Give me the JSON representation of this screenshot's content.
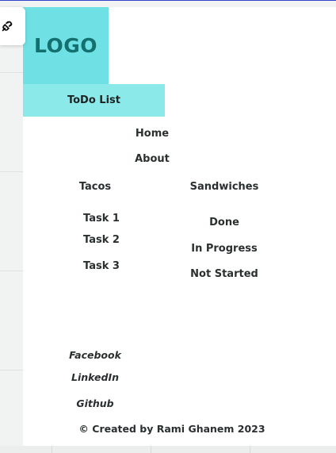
{
  "logo": {
    "text": "LOGO"
  },
  "sidebar": {
    "title": "ToDo List"
  },
  "nav": {
    "home": "Home",
    "about": "About"
  },
  "columns": {
    "left": "Tacos",
    "right": "Sandwiches"
  },
  "tasks": [
    "Task 1",
    "Task 2",
    "Task 3"
  ],
  "statuses": [
    "Done",
    "In Progress",
    "Not Started"
  ],
  "social": {
    "facebook": "Facebook",
    "linkedin": "LinkedIn",
    "github": "Github"
  },
  "footer": {
    "text": "© Created by Rami Ghanem 2023"
  },
  "colors": {
    "logo_bg": "#6fe1e5",
    "title_bg": "#8ce9ea",
    "logo_text": "#13706f"
  },
  "icons": {
    "corner_button": "unplug-icon"
  }
}
